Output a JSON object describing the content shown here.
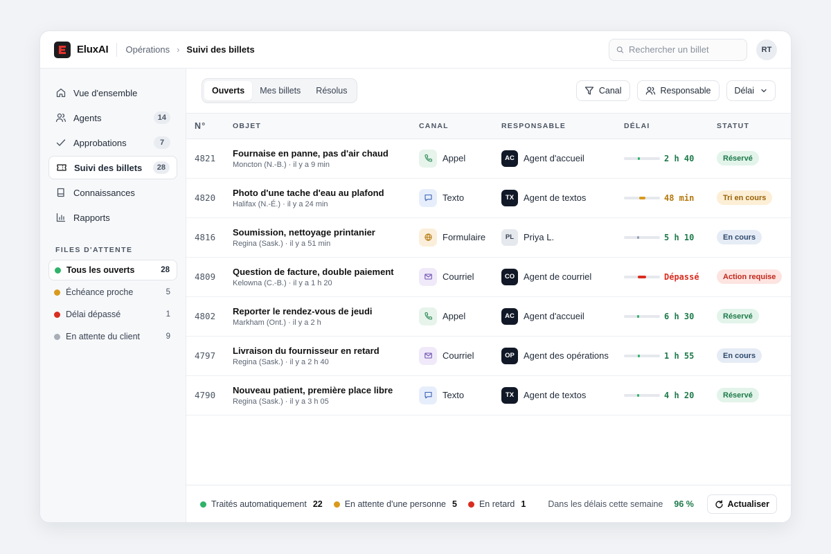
{
  "header": {
    "brand": "EluxAI",
    "breadcrumb_parent": "Opérations",
    "breadcrumb_current": "Suivi des billets",
    "search_placeholder": "Rechercher un billet",
    "avatar_initials": "RT"
  },
  "sidebar": {
    "nav": [
      {
        "label": "Vue d'ensemble",
        "icon": "home-icon",
        "count": ""
      },
      {
        "label": "Agents",
        "icon": "users-icon",
        "count": "14"
      },
      {
        "label": "Approbations",
        "icon": "check-icon",
        "count": "7"
      },
      {
        "label": "Suivi des billets",
        "icon": "ticket-icon",
        "count": "28",
        "active": true
      },
      {
        "label": "Connaissances",
        "icon": "book-icon",
        "count": ""
      },
      {
        "label": "Rapports",
        "icon": "chart-icon",
        "count": ""
      }
    ],
    "queues_title": "FILES D'ATTENTE",
    "queues": [
      {
        "label": "Tous les ouverts",
        "count": "28",
        "color": "#2fb36a",
        "active": true
      },
      {
        "label": "Échéance proche",
        "count": "5",
        "color": "#d99a1c"
      },
      {
        "label": "Délai dépassé",
        "count": "1",
        "color": "#d92d20"
      },
      {
        "label": "En attente du client",
        "count": "9",
        "color": "#a8aeb8"
      }
    ]
  },
  "toolbar": {
    "tabs": [
      "Ouverts",
      "Mes billets",
      "Résolus"
    ],
    "active_tab": "Ouverts",
    "filter_channel": "Canal",
    "filter_assignee": "Responsable",
    "filter_delay": "Délai"
  },
  "table": {
    "headers": {
      "num": "N°",
      "subject": "OBJET",
      "channel": "CANAL",
      "assignee": "RESPONSABLE",
      "delay": "DÉLAI",
      "status": "STATUT"
    },
    "rows": [
      {
        "num": "4821",
        "subject": "Fournaise en panne, pas d'air chaud",
        "meta": "Moncton (N.-B.) · il y a 9 min",
        "channel": "Appel",
        "channel_kind": "call",
        "initials": "AC",
        "assignee": "Agent d'accueil",
        "assignee_style": "dark",
        "delay": "2 h 40",
        "delay_level": 0.42,
        "delay_tone": "ok",
        "status": "Réservé",
        "status_tone": "green"
      },
      {
        "num": "4820",
        "subject": "Photo d'une tache d'eau au plafond",
        "meta": "Halifax (N.-É.) · il y a 24 min",
        "channel": "Texto",
        "channel_kind": "text",
        "initials": "TX",
        "assignee": "Agent de textos",
        "assignee_style": "dark",
        "delay": "48 min",
        "delay_level": 0.5,
        "delay_tone": "warn",
        "status": "Tri en cours",
        "status_tone": "amber"
      },
      {
        "num": "4816",
        "subject": "Soumission, nettoyage printanier",
        "meta": "Regina (Sask.) · il y a 51 min",
        "channel": "Formulaire",
        "channel_kind": "form",
        "initials": "PL",
        "assignee": "Priya L.",
        "assignee_style": "light",
        "delay": "5 h 10",
        "delay_level": 0.4,
        "delay_tone": "neutral",
        "status": "En cours",
        "status_tone": "blue"
      },
      {
        "num": "4809",
        "subject": "Question de facture, double paiement",
        "meta": "Kelowna (C.-B.) · il y a 1 h 20",
        "channel": "Courriel",
        "channel_kind": "mail",
        "initials": "CO",
        "assignee": "Agent de courriel",
        "assignee_style": "dark",
        "delay": "Dépassé",
        "delay_level": 0.5,
        "delay_tone": "over",
        "status": "Action requise",
        "status_tone": "red"
      },
      {
        "num": "4802",
        "subject": "Reporter le rendez-vous de jeudi",
        "meta": "Markham (Ont.) · il y a 2 h",
        "channel": "Appel",
        "channel_kind": "call",
        "initials": "AC",
        "assignee": "Agent d'accueil",
        "assignee_style": "dark",
        "delay": "6 h 30",
        "delay_level": 0.4,
        "delay_tone": "ok",
        "status": "Réservé",
        "status_tone": "green"
      },
      {
        "num": "4797",
        "subject": "Livraison du fournisseur en retard",
        "meta": "Regina (Sask.) · il y a 2 h 40",
        "channel": "Courriel",
        "channel_kind": "mail",
        "initials": "OP",
        "assignee": "Agent des opérations",
        "assignee_style": "dark",
        "delay": "1 h 55",
        "delay_level": 0.42,
        "delay_tone": "ok",
        "status": "En cours",
        "status_tone": "blue"
      },
      {
        "num": "4790",
        "subject": "Nouveau patient, première place libre",
        "meta": "Regina (Sask.) · il y a 3 h 05",
        "channel": "Texto",
        "channel_kind": "text",
        "initials": "TX",
        "assignee": "Agent de textos",
        "assignee_style": "dark",
        "delay": "4 h 20",
        "delay_level": 0.4,
        "delay_tone": "ok",
        "status": "Réservé",
        "status_tone": "green"
      }
    ]
  },
  "footer": {
    "stats": [
      {
        "label": "Traités automatiquement",
        "value": "22",
        "color": "#2fb36a"
      },
      {
        "label": "En attente d'une personne",
        "value": "5",
        "color": "#d99a1c"
      },
      {
        "label": "En retard",
        "value": "1",
        "color": "#d92d20"
      }
    ],
    "week_label": "Dans les délais cette semaine",
    "week_pct": "96 %",
    "refresh_label": "Actualiser"
  },
  "colors": {
    "brand": "#e5322d",
    "green": "#2fb36a",
    "amber": "#d99a1c",
    "red": "#d92d20"
  }
}
